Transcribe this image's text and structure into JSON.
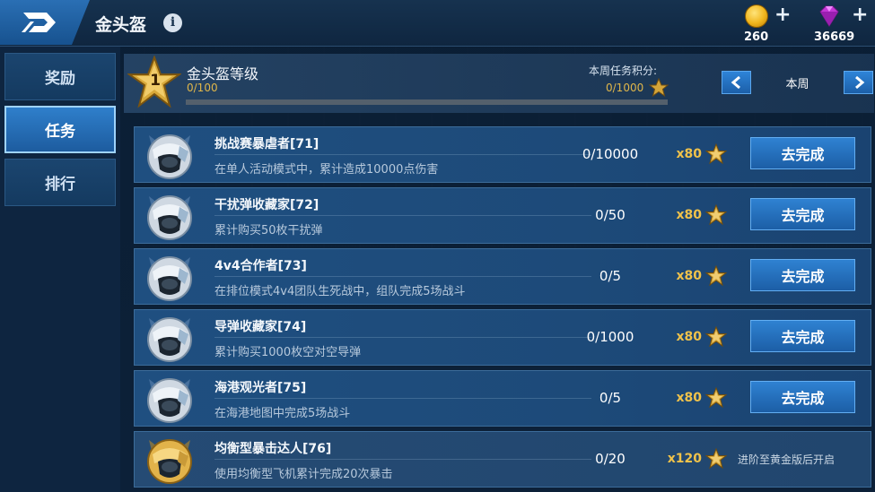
{
  "header": {
    "title": "金头盔",
    "back_icon": "back-logo-icon",
    "info_icon": "i",
    "gold": {
      "value": "260",
      "icon": "gold-coin-icon",
      "plus": "+"
    },
    "gems": {
      "value": "36669",
      "icon": "purple-gem-icon",
      "plus": "+"
    }
  },
  "sidebar": {
    "items": [
      {
        "label": "奖励",
        "active": false
      },
      {
        "label": "任务",
        "active": true
      },
      {
        "label": "排行",
        "active": false
      }
    ]
  },
  "level": {
    "title": "金头盔等级",
    "rank": "1",
    "progress_text": "0/100",
    "progress_fraction": 0,
    "weekly_label": "本周任务积分:",
    "weekly_points": "0/1000",
    "week_selector": "本周"
  },
  "tasks": [
    {
      "name": "挑战赛暴虐者[71]",
      "desc": "在单人活动模式中，累计造成10000点伤害",
      "progress": "0/10000",
      "reward": "x80",
      "action": "去完成",
      "helmet": "silver"
    },
    {
      "name": "干扰弹收藏家[72]",
      "desc": "累计购买50枚干扰弹",
      "progress": "0/50",
      "reward": "x80",
      "action": "去完成",
      "helmet": "silver"
    },
    {
      "name": "4v4合作者[73]",
      "desc": "在排位模式4v4团队生死战中，组队完成5场战斗",
      "progress": "0/5",
      "reward": "x80",
      "action": "去完成",
      "helmet": "silver"
    },
    {
      "name": "导弹收藏家[74]",
      "desc": "累计购买1000枚空对空导弹",
      "progress": "0/1000",
      "reward": "x80",
      "action": "去完成",
      "helmet": "silver"
    },
    {
      "name": "海港观光者[75]",
      "desc": "在海港地图中完成5场战斗",
      "progress": "0/5",
      "reward": "x80",
      "action": "去完成",
      "helmet": "silver"
    },
    {
      "name": "均衡型暴击达人[76]",
      "desc": "使用均衡型飞机累计完成20次暴击",
      "progress": "0/20",
      "reward": "x120",
      "action": "进阶至黄金版后开启",
      "helmet": "gold"
    }
  ],
  "colors": {
    "accent_blue": "#2f82d2",
    "gold": "#e0b64a",
    "panel": "#1f4f80"
  }
}
